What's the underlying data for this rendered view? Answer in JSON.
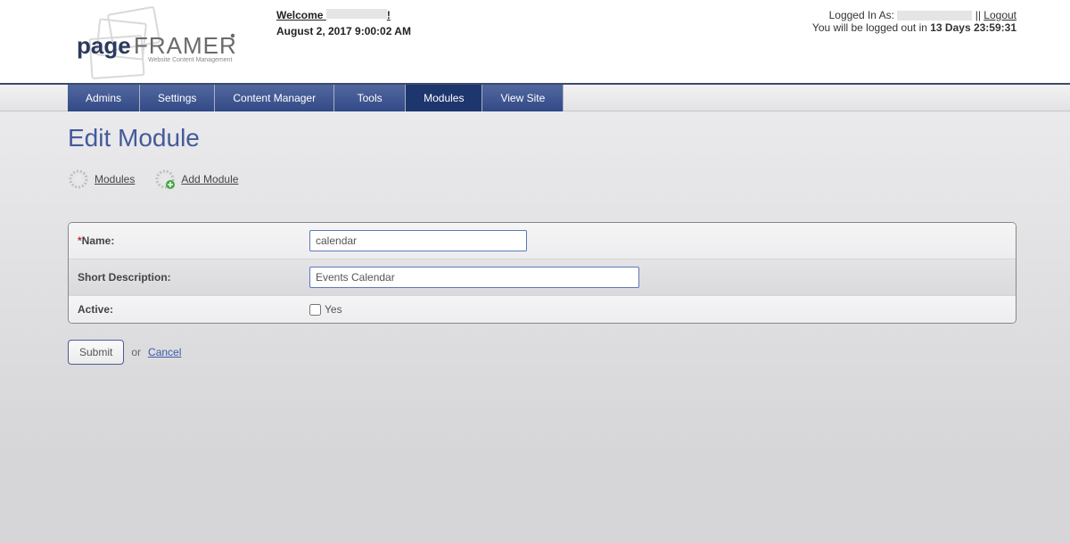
{
  "header": {
    "welcome_prefix": "Welcome",
    "welcome_suffix": "!",
    "date": "August 2, 2017 9:00:02 AM",
    "logged_in_as_label": "Logged In As:",
    "logout_sep": " || ",
    "logout_label": "Logout",
    "countdown_prefix": "You will be logged out in ",
    "countdown_value": "13 Days 23:59:31"
  },
  "logo": {
    "brand_page": "page",
    "brand_framer": "FRAMER",
    "tagline": "Website Content Management"
  },
  "nav": {
    "items": [
      {
        "label": "Admins",
        "active": false
      },
      {
        "label": "Settings",
        "active": false
      },
      {
        "label": "Content Manager",
        "active": false
      },
      {
        "label": "Tools",
        "active": false
      },
      {
        "label": "Modules",
        "active": true
      },
      {
        "label": "View Site",
        "active": false
      }
    ]
  },
  "page": {
    "title": "Edit Module",
    "actions": {
      "modules": "Modules",
      "add": "Add Module"
    }
  },
  "form": {
    "name_label": "Name:",
    "name_value": "calendar",
    "desc_label": "Short Description:",
    "desc_value": "Events Calendar",
    "active_label": "Active:",
    "active_yes": "Yes",
    "active_checked": false
  },
  "buttons": {
    "submit": "Submit",
    "or": "or",
    "cancel": "Cancel"
  }
}
